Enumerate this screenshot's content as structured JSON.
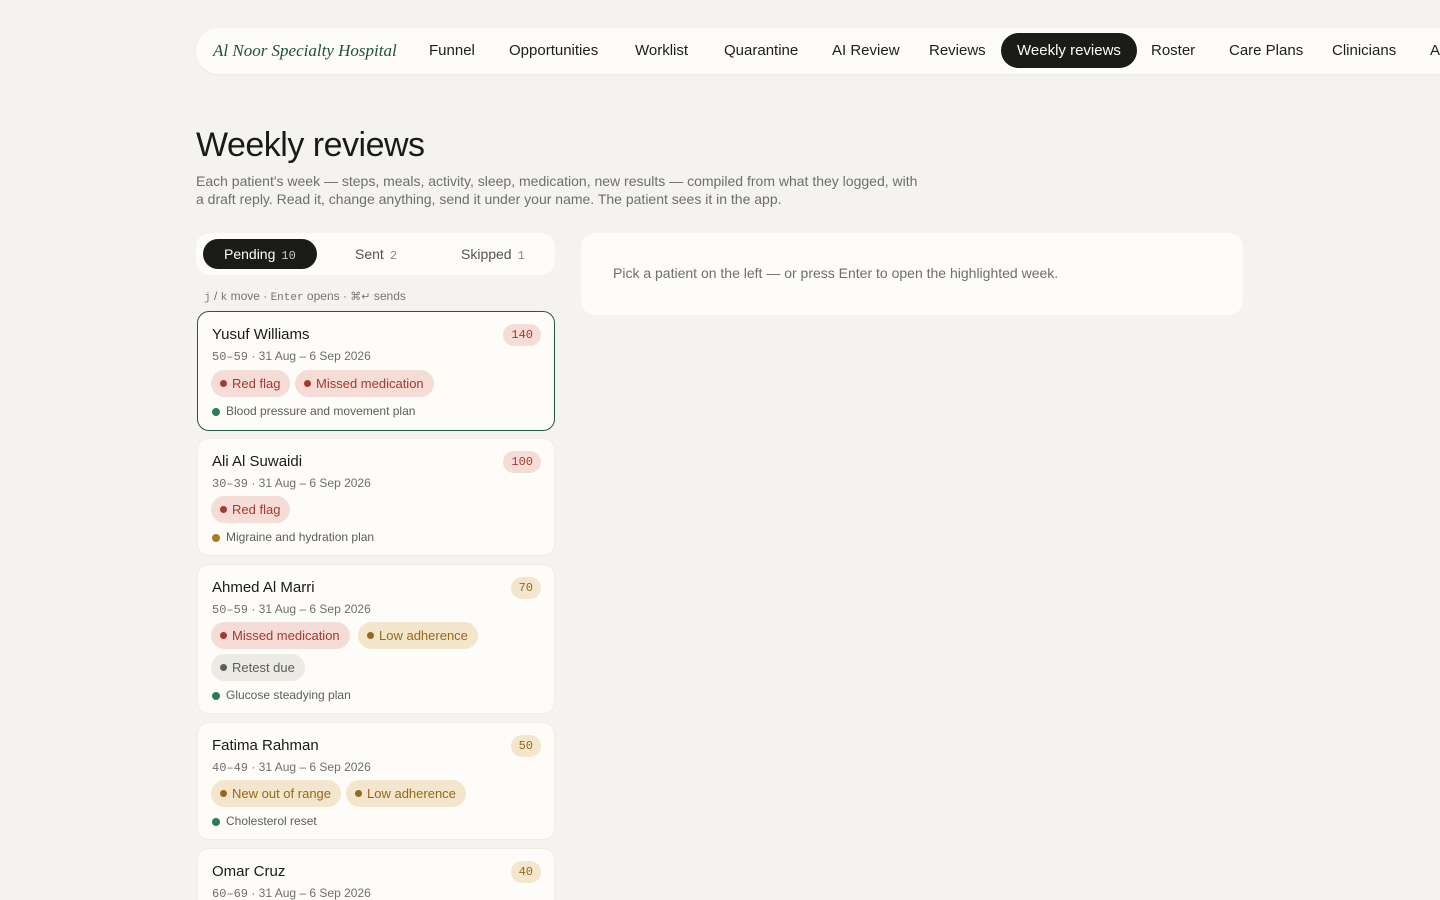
{
  "app": {
    "brand": "Al Noor Specialty Hospital"
  },
  "nav": {
    "items": [
      {
        "label": "Funnel"
      },
      {
        "label": "Opportunities"
      },
      {
        "label": "Worklist"
      },
      {
        "label": "Quarantine"
      },
      {
        "label": "AI Review"
      },
      {
        "label": "Reviews"
      },
      {
        "label": "Weekly reviews",
        "active": true
      },
      {
        "label": "Roster"
      },
      {
        "label": "Care Plans"
      },
      {
        "label": "Clinicians"
      },
      {
        "label": "A"
      }
    ]
  },
  "page": {
    "title": "Weekly reviews",
    "subtitle_line1": "Each patient's week — steps, meals, activity, sleep, medication, new results — compiled from what they logged, with",
    "subtitle_line2": "a draft reply. Read it, change anything, send it under your name. The patient sees it in the app."
  },
  "tabs": [
    {
      "label": "Pending",
      "count": "10",
      "active": true
    },
    {
      "label": "Sent",
      "count": "2"
    },
    {
      "label": "Skipped",
      "count": "1"
    }
  ],
  "hint": {
    "k1": "j",
    "sep1": " / ",
    "k2": "k",
    "t1": " move · ",
    "k3": "Enter",
    "t2": " opens · ",
    "k4": "⌘↵",
    "t3": " sends"
  },
  "patients": [
    {
      "name": "Yusuf Williams",
      "age": "50–59",
      "dates": " · 31 Aug – 6 Sep 2026",
      "score": "140",
      "flags": [
        {
          "label": "Red flag"
        },
        {
          "label": "Missed medication"
        }
      ],
      "plan": "Blood pressure and movement plan"
    },
    {
      "name": "Ali Al Suwaidi",
      "age": "30–39",
      "dates": " · 31 Aug – 6 Sep 2026",
      "score": "100",
      "flags": [
        {
          "label": "Red flag"
        }
      ],
      "plan": "Migraine and hydration plan"
    },
    {
      "name": "Ahmed Al Marri",
      "age": "50–59",
      "dates": " · 31 Aug – 6 Sep 2026",
      "score": "70",
      "flags": [
        {
          "label": "Missed medication"
        },
        {
          "label": "Low adherence"
        },
        {
          "label": "Retest due"
        }
      ],
      "plan": "Glucose steadying plan"
    },
    {
      "name": "Fatima Rahman",
      "age": "40–49",
      "dates": " · 31 Aug – 6 Sep 2026",
      "score": "50",
      "flags": [
        {
          "label": "New out of range"
        },
        {
          "label": "Low adherence"
        }
      ],
      "plan": "Cholesterol reset"
    },
    {
      "name": "Omar Cruz",
      "age": "60–69",
      "dates": " · 31 Aug – 6 Sep 2026",
      "score": "40"
    }
  ],
  "detail": {
    "empty_message": "Pick a patient on the left — or press Enter to open the highlighted week."
  },
  "colors": {
    "accent": "#1f5a46",
    "red": "#a53a2e",
    "amber": "#94691b",
    "green_dot": "#2b7a5a",
    "amber_dot": "#a77d1f"
  }
}
